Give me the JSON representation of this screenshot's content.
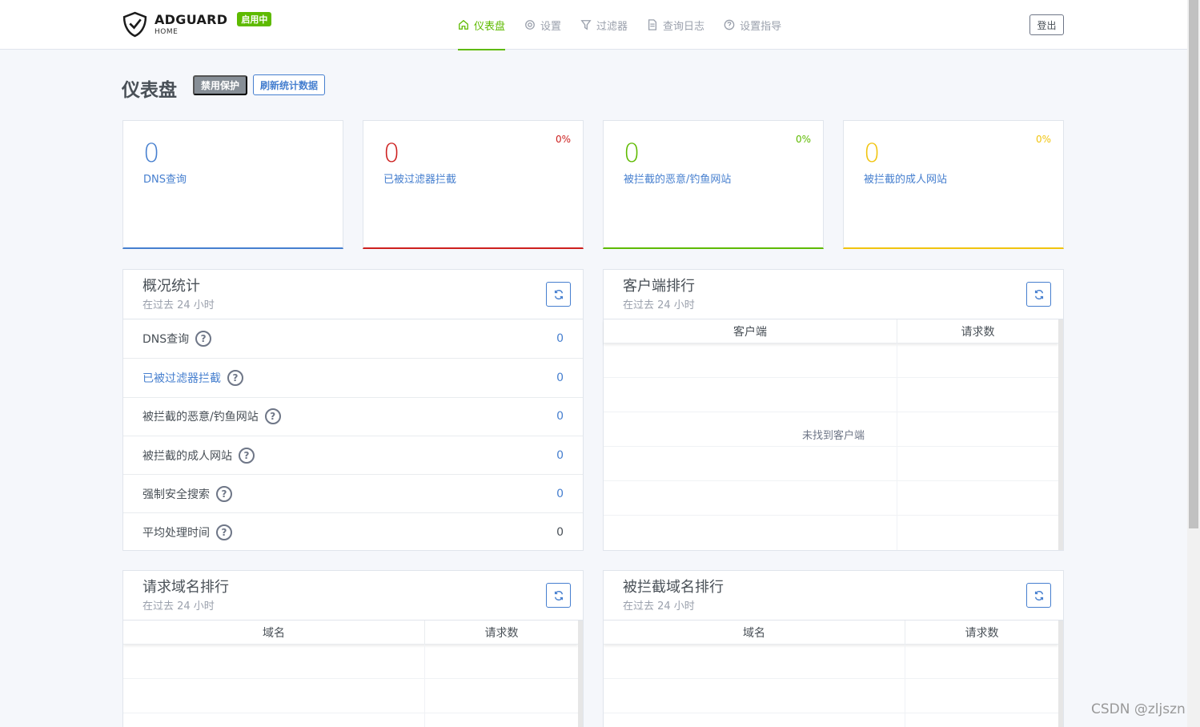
{
  "header": {
    "logo_title": "ADGUARD",
    "logo_subtitle": "HOME",
    "status_badge": "启用中",
    "nav": [
      {
        "label": "仪表盘",
        "icon": "home-icon",
        "active": true
      },
      {
        "label": "设置",
        "icon": "gear-icon"
      },
      {
        "label": "过滤器",
        "icon": "filter-icon"
      },
      {
        "label": "查询日志",
        "icon": "document-icon"
      },
      {
        "label": "设置指导",
        "icon": "help-icon"
      }
    ],
    "logout_label": "登出"
  },
  "page": {
    "title": "仪表盘",
    "disable_protection_label": "禁用保护",
    "refresh_stats_label": "刷新统计数据"
  },
  "counters": [
    {
      "value": "0",
      "label": "DNS查询",
      "percent": "",
      "color": "#467fcf"
    },
    {
      "value": "0",
      "label": "已被过滤器拦截",
      "percent": "0%",
      "color": "#cd201f"
    },
    {
      "value": "0",
      "label": "被拦截的恶意/钓鱼网站",
      "percent": "0%",
      "color": "#5eba00"
    },
    {
      "value": "0",
      "label": "被拦截的成人网站",
      "percent": "0%",
      "color": "#f1c40f"
    }
  ],
  "overview": {
    "title": "概况统计",
    "subtitle": "在过去 24 小时",
    "rows": [
      {
        "label": "DNS查询",
        "value": "0"
      },
      {
        "label": "已被过滤器拦截",
        "value": "0"
      },
      {
        "label": "被拦截的恶意/钓鱼网站",
        "value": "0"
      },
      {
        "label": "被拦截的成人网站",
        "value": "0"
      },
      {
        "label": "强制安全搜索",
        "value": "0"
      },
      {
        "label": "平均处理时间",
        "value": "0"
      }
    ]
  },
  "clients": {
    "title": "客户端排行",
    "subtitle": "在过去 24 小时",
    "col1": "客户端",
    "col2": "请求数",
    "empty": "未找到客户端"
  },
  "domains": {
    "title": "请求域名排行",
    "subtitle": "在过去 24 小时",
    "col1": "域名",
    "col2": "请求数"
  },
  "blocked_domains": {
    "title": "被拦截域名排行",
    "subtitle": "在过去 24 小时",
    "col1": "域名",
    "col2": "请求数"
  },
  "watermark": "CSDN @zljszn"
}
